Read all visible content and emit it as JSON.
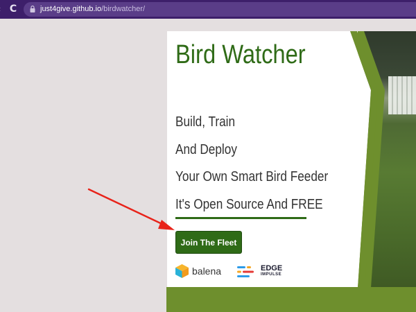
{
  "browser": {
    "url_host": "just4give.github.io",
    "url_path": "/birdwatcher/",
    "icons": [
      "back-icon",
      "reload-icon",
      "lock-icon"
    ]
  },
  "page": {
    "title": "Bird Watcher",
    "taglines": [
      "Build, Train",
      "And Deploy",
      "Your Own Smart Bird Feeder",
      "It's Open Source And FREE"
    ],
    "cta_label": "Join The Fleet",
    "partners": {
      "balena": "balena",
      "edge": "EDGE",
      "edge_sub": "IMPULSE"
    }
  },
  "colors": {
    "accent_green": "#2f6b17",
    "band_green": "#6e8f2d",
    "browser_purple": "#3d1f6a",
    "annotation_red": "#e8231a"
  }
}
